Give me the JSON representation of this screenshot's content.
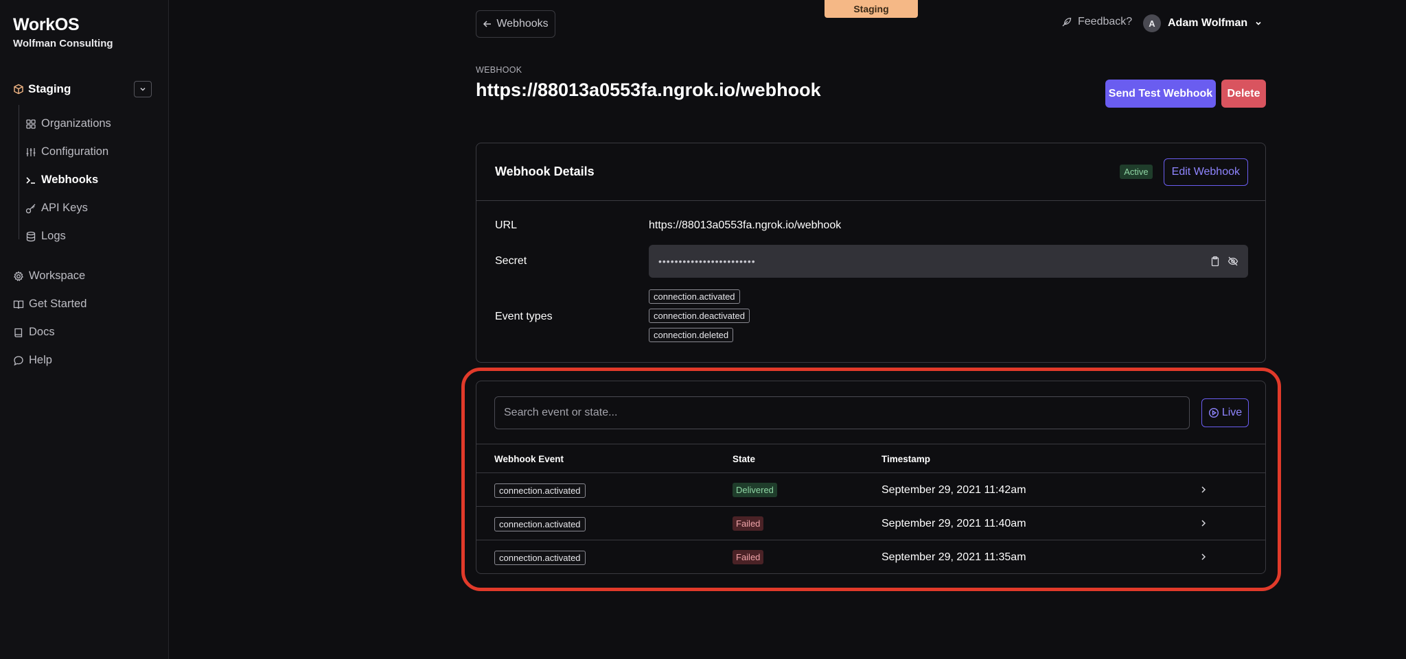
{
  "app": {
    "brand": "WorkOS",
    "organization": "Wolfman Consulting"
  },
  "environment": {
    "label": "Staging",
    "banner": "Staging"
  },
  "sidebar": {
    "sub_items": [
      {
        "label": "Organizations",
        "icon": "grid-icon"
      },
      {
        "label": "Configuration",
        "icon": "sliders-icon"
      },
      {
        "label": "Webhooks",
        "icon": "terminal-icon",
        "active": true
      },
      {
        "label": "API Keys",
        "icon": "key-icon"
      },
      {
        "label": "Logs",
        "icon": "database-icon"
      }
    ],
    "main_items": [
      {
        "label": "Workspace",
        "icon": "gear-icon"
      },
      {
        "label": "Get Started",
        "icon": "book-open-icon"
      },
      {
        "label": "Docs",
        "icon": "book-icon"
      },
      {
        "label": "Help",
        "icon": "chat-bubble-icon"
      }
    ]
  },
  "topbar": {
    "back_label": "Webhooks",
    "feedback_label": "Feedback?",
    "user_initial": "A",
    "user_name": "Adam Wolfman"
  },
  "header": {
    "kicker": "WEBHOOK",
    "title": "https://88013a0553fa.ngrok.io/webhook",
    "send_test_label": "Send Test Webhook",
    "delete_label": "Delete"
  },
  "details": {
    "title": "Webhook Details",
    "status": "Active",
    "edit_label": "Edit Webhook",
    "url_label": "URL",
    "url_value": "https://88013a0553fa.ngrok.io/webhook",
    "secret_label": "Secret",
    "secret_mask": "••••••••••••••••••••••••",
    "event_types_label": "Event types",
    "event_types": [
      "connection.activated",
      "connection.deactivated",
      "connection.deleted"
    ]
  },
  "events": {
    "search_placeholder": "Search event or state...",
    "live_label": "Live",
    "columns": [
      "Webhook Event",
      "State",
      "Timestamp"
    ],
    "rows": [
      {
        "event": "connection.activated",
        "state": "Delivered",
        "timestamp": "September 29, 2021 11:42am"
      },
      {
        "event": "connection.activated",
        "state": "Failed",
        "timestamp": "September 29, 2021 11:40am"
      },
      {
        "event": "connection.activated",
        "state": "Failed",
        "timestamp": "September 29, 2021 11:35am"
      }
    ]
  },
  "colors": {
    "accent": "#6a5df0",
    "danger": "#d9545f",
    "highlight": "#e13a2a",
    "banner": "#f5b886",
    "success_bg": "#1f3d2b",
    "failed_bg": "#4a2226"
  }
}
